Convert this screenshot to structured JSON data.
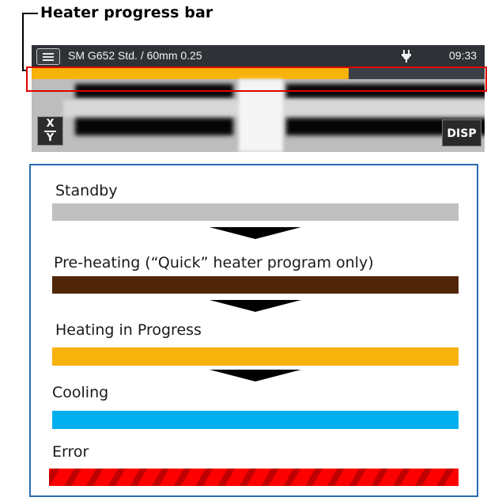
{
  "callout": {
    "title": "Heater progress bar"
  },
  "device": {
    "status_title": "SM G652 Std. / 60mm 0.25",
    "time": "09:33",
    "icons": {
      "menu": "menu-icon",
      "power": "plug-icon",
      "xy_top": "X",
      "xy_bottom": "Y"
    },
    "disp_label": "DISP",
    "progress": {
      "value": 0.7,
      "color": "#f7b20c",
      "track_color": "#3b4047"
    }
  },
  "legend": {
    "states": [
      {
        "label": "Standby",
        "color": "#c0c0c0"
      },
      {
        "label": "Pre-heating (“Quick” heater program only)",
        "color": "#4f2608"
      },
      {
        "label": "Heating in Progress",
        "color": "#f7b20c"
      },
      {
        "label": "Cooling",
        "color": "#00b0ee"
      },
      {
        "label": "Error",
        "colors": [
          "#ff0000",
          "#c00000"
        ]
      }
    ]
  }
}
